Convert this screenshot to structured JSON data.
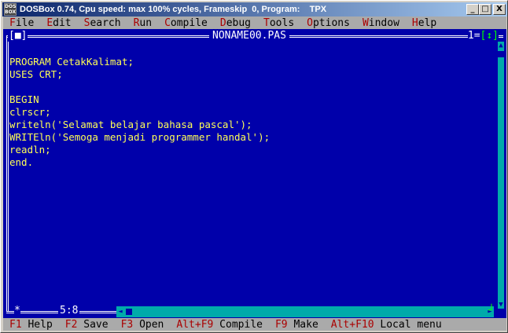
{
  "window": {
    "title": "DOSBox 0.74, Cpu speed: max 100% cycles, Frameskip  0, Program:    TPX",
    "icon_label": "DOS BOX",
    "minimize_glyph": "_",
    "maximize_glyph": "□",
    "close_glyph": "X"
  },
  "menu": {
    "items": [
      {
        "hot": "F",
        "rest": "ile"
      },
      {
        "hot": "E",
        "rest": "dit"
      },
      {
        "hot": "S",
        "rest": "earch"
      },
      {
        "hot": "R",
        "rest": "un"
      },
      {
        "hot": "C",
        "rest": "ompile"
      },
      {
        "hot": "D",
        "rest": "ebug"
      },
      {
        "hot": "T",
        "rest": "ools"
      },
      {
        "hot": "O",
        "rest": "ptions"
      },
      {
        "hot": "W",
        "rest": "indow"
      },
      {
        "hot": "H",
        "rest": "elp"
      }
    ]
  },
  "editor": {
    "file_name": "NONAME00.PAS",
    "close_box": "[■]",
    "window_number": "1",
    "zoom_box": "[↕]",
    "modified_marker": "*",
    "cursor_position": "5:8",
    "lines": [
      "PROGRAM CetakKalimat;",
      "USES CRT;",
      "",
      "BEGIN",
      "clrscr;",
      "writeln('Selamat belajar bahasa pascal');",
      "WRITEln('Semoga menjadi programmer handal');",
      "readln;",
      "end."
    ]
  },
  "statusbar": {
    "items": [
      {
        "key": "F1",
        "label": " Help"
      },
      {
        "key": "F2",
        "label": " Save"
      },
      {
        "key": "F3",
        "label": " Open"
      },
      {
        "key": "Alt+F9",
        "label": " Compile"
      },
      {
        "key": "F9",
        "label": " Make"
      },
      {
        "key": "Alt+F10",
        "label": " Local menu"
      }
    ]
  },
  "colors": {
    "editor_bg": "#0000aa",
    "code_text": "#ffff55",
    "menu_bg": "#aaaaaa",
    "hotkey": "#aa0000",
    "scrollbar": "#00aaaa"
  }
}
